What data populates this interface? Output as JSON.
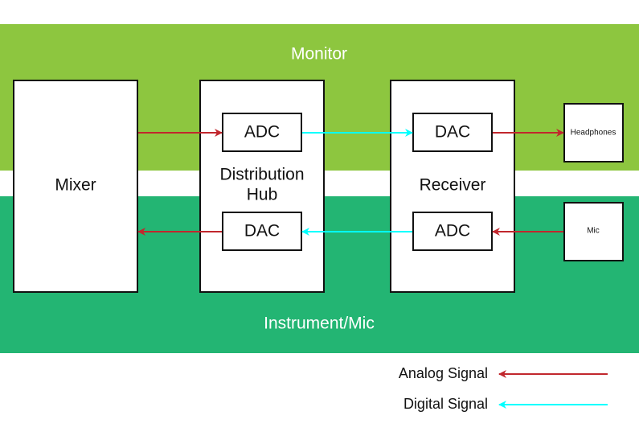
{
  "zones": {
    "monitor": "Monitor",
    "instrument": "Instrument/Mic"
  },
  "blocks": {
    "mixer": "Mixer",
    "hub_line1": "Distribution",
    "hub_line2": "Hub",
    "hub_adc": "ADC",
    "hub_dac": "DAC",
    "receiver": "Receiver",
    "receiver_dac": "DAC",
    "receiver_adc": "ADC",
    "headphones": "Headphones",
    "mic": "Mic"
  },
  "legend": {
    "analog": "Analog Signal",
    "digital": "Digital Signal"
  },
  "colors": {
    "monitor_band": "#8dc63f",
    "instrument_band": "#23b573",
    "analog": "#c1272d",
    "digital": "#00ffff"
  }
}
